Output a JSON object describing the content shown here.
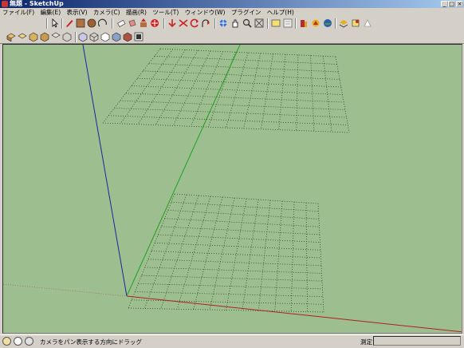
{
  "window": {
    "title": "無題 - SketchUp"
  },
  "menu": {
    "items": [
      "ファイル(F)",
      "編集(E)",
      "表示(V)",
      "カメラ(C)",
      "描画(R)",
      "ツール(T)",
      "ウィンドウ(W)",
      "プラグイン",
      "ヘルプ(H)"
    ]
  },
  "toolbar": {
    "row1": [
      "select-icon",
      "pencil-icon",
      "rectangle-icon",
      "circle-icon",
      "arc-icon",
      "eraser-icon",
      "paint-bucket-icon",
      "push-pull-icon",
      "move-icon",
      "rotate-icon",
      "follow-me-icon",
      "scale-icon",
      "offset-icon",
      "orbit-icon",
      "pan-icon",
      "zoom-icon",
      "zoom-extents-icon",
      "components-icon",
      "section-icon",
      "get-models-icon",
      "share-model-icon",
      "photo-textures-icon",
      "layers-icon"
    ],
    "row2": [
      "view-iso-icon",
      "view-top-icon",
      "view-front-icon",
      "view-right-icon",
      "view-back-icon",
      "view-left-icon",
      "xray-icon",
      "wireframe-icon",
      "hidden-line-icon",
      "shaded-icon",
      "shaded-textures-icon",
      "monochrome-icon"
    ]
  },
  "viewport": {
    "background": "#9dbf8f"
  },
  "status": {
    "hint": "カメラをパン表示する方向にドラッグ",
    "measure_label": "測定",
    "measure_value": ""
  }
}
